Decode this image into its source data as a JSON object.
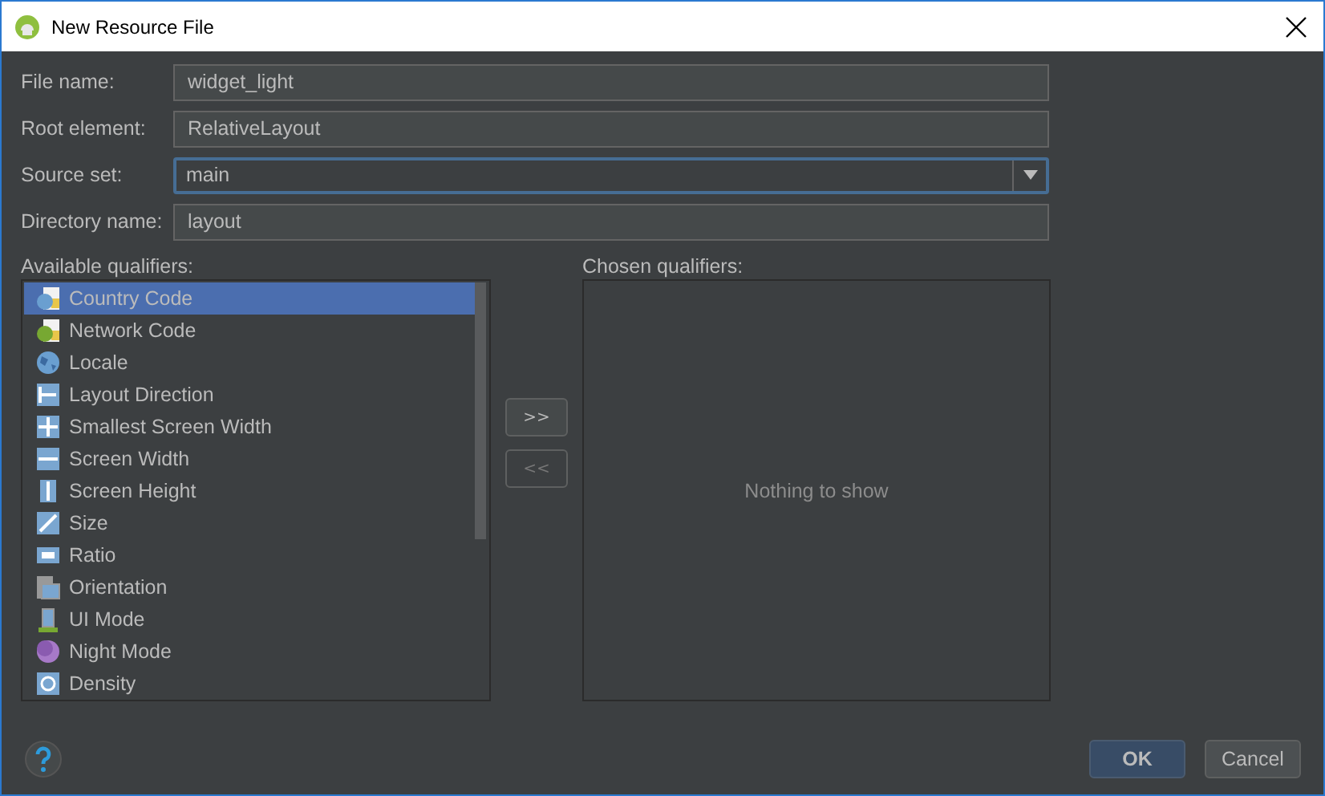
{
  "window": {
    "title": "New Resource File"
  },
  "fields": [
    {
      "label": "File name:",
      "kind": "text",
      "value": "widget_light",
      "focused": false
    },
    {
      "label": "Root element:",
      "kind": "text",
      "value": "RelativeLayout",
      "focused": false
    },
    {
      "label": "Source set:",
      "kind": "dropdown",
      "value": "main",
      "focused": true
    },
    {
      "label": "Directory name:",
      "kind": "text",
      "value": "layout",
      "focused": false
    }
  ],
  "available": {
    "label": "Available qualifiers:",
    "items": [
      {
        "label": "Country Code",
        "kind": "sim",
        "selected": true
      },
      {
        "label": "Network Code",
        "kind": "network",
        "selected": false
      },
      {
        "label": "Locale",
        "kind": "globe",
        "selected": false
      },
      {
        "label": "Layout Direction",
        "kind": "direction",
        "selected": false
      },
      {
        "label": "Smallest Screen Width",
        "kind": "move",
        "selected": false
      },
      {
        "label": "Screen Width",
        "kind": "width",
        "selected": false
      },
      {
        "label": "Screen Height",
        "kind": "height",
        "selected": false
      },
      {
        "label": "Size",
        "kind": "size",
        "selected": false
      },
      {
        "label": "Ratio",
        "kind": "ratio",
        "selected": false
      },
      {
        "label": "Orientation",
        "kind": "orientation",
        "selected": false
      },
      {
        "label": "UI Mode",
        "kind": "uimode",
        "selected": false
      },
      {
        "label": "Night Mode",
        "kind": "night",
        "selected": false
      },
      {
        "label": "Density",
        "kind": "density",
        "selected": false
      }
    ]
  },
  "transfer_buttons": [
    {
      "label": ">>",
      "disabled": false
    },
    {
      "label": "<<",
      "disabled": true
    }
  ],
  "chosen": {
    "label": "Chosen qualifiers:",
    "empty_text": "Nothing to show"
  },
  "buttons": [
    {
      "label": "OK",
      "default": true
    },
    {
      "label": "Cancel",
      "default": false
    }
  ]
}
